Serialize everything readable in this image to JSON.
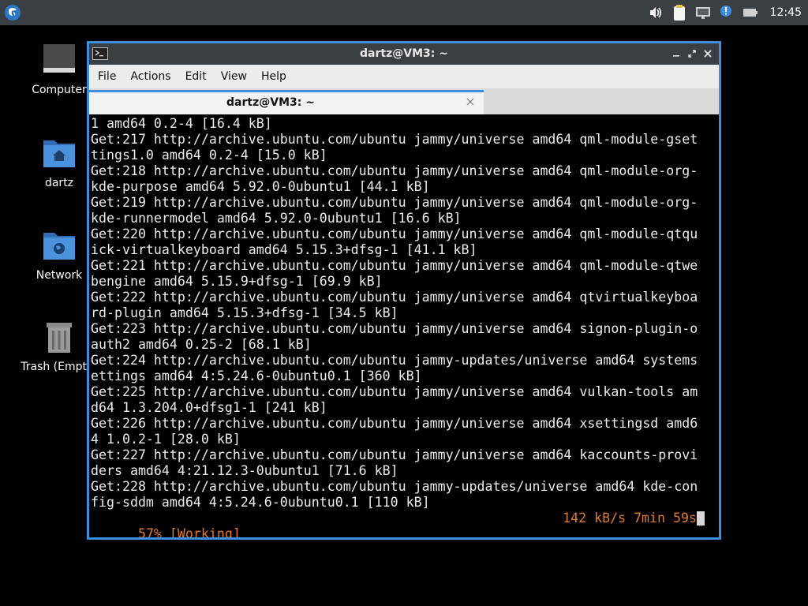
{
  "panel": {
    "clock": "12:45",
    "start_icon": "lxqt-start-icon",
    "tray": [
      "volume-icon",
      "clipboard-icon",
      "network-icon",
      "notification-icon",
      "battery-icon"
    ]
  },
  "desktop": {
    "icons": [
      {
        "label": "Computer",
        "icon": "computer-icon"
      },
      {
        "label": "dartz",
        "icon": "home-folder-icon"
      },
      {
        "label": "Network",
        "icon": "network-folder-icon"
      },
      {
        "label": "Trash (Empty)",
        "icon": "trash-icon"
      }
    ]
  },
  "window": {
    "title": "dartz@VM3: ~",
    "menu": [
      "File",
      "Actions",
      "Edit",
      "View",
      "Help"
    ],
    "tab_title": "dartz@VM3: ~"
  },
  "terminal": {
    "lines": [
      "1 amd64 0.2-4 [16.4 kB]",
      "Get:217 http://archive.ubuntu.com/ubuntu jammy/universe amd64 qml-module-gset",
      "tings1.0 amd64 0.2-4 [15.0 kB]",
      "Get:218 http://archive.ubuntu.com/ubuntu jammy/universe amd64 qml-module-org-",
      "kde-purpose amd64 5.92.0-0ubuntu1 [44.1 kB]",
      "Get:219 http://archive.ubuntu.com/ubuntu jammy/universe amd64 qml-module-org-",
      "kde-runnermodel amd64 5.92.0-0ubuntu1 [16.6 kB]",
      "Get:220 http://archive.ubuntu.com/ubuntu jammy/universe amd64 qml-module-qtqu",
      "ick-virtualkeyboard amd64 5.15.3+dfsg-1 [41.1 kB]",
      "Get:221 http://archive.ubuntu.com/ubuntu jammy/universe amd64 qml-module-qtwe",
      "bengine amd64 5.15.9+dfsg-1 [69.9 kB]",
      "Get:222 http://archive.ubuntu.com/ubuntu jammy/universe amd64 qtvirtualkeyboa",
      "rd-plugin amd64 5.15.3+dfsg-1 [34.5 kB]",
      "Get:223 http://archive.ubuntu.com/ubuntu jammy/universe amd64 signon-plugin-o",
      "auth2 amd64 0.25-2 [68.1 kB]",
      "Get:224 http://archive.ubuntu.com/ubuntu jammy-updates/universe amd64 systems",
      "ettings amd64 4:5.24.6-0ubuntu0.1 [360 kB]",
      "Get:225 http://archive.ubuntu.com/ubuntu jammy/universe amd64 vulkan-tools am",
      "d64 1.3.204.0+dfsg1-1 [241 kB]",
      "Get:226 http://archive.ubuntu.com/ubuntu jammy/universe amd64 xsettingsd amd6",
      "4 1.0.2-1 [28.0 kB]",
      "Get:227 http://archive.ubuntu.com/ubuntu jammy/universe amd64 kaccounts-provi",
      "ders amd64 4:21.12.3-0ubuntu1 [71.6 kB]",
      "Get:228 http://archive.ubuntu.com/ubuntu jammy-updates/universe amd64 kde-con",
      "fig-sddm amd64 4:5.24.6-0ubuntu0.1 [110 kB]"
    ],
    "status_left": "57% [Working]",
    "status_right": "142 kB/s 7min 59s",
    "status_color": "#e07a2b",
    "accent_color": "#3d8ee0"
  }
}
